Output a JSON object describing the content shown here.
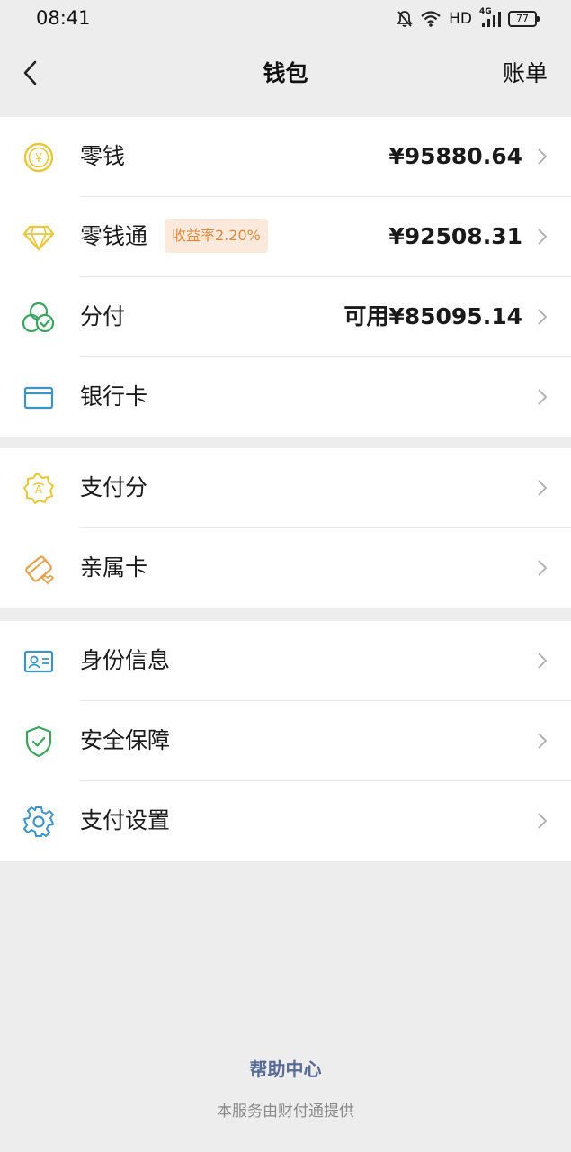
{
  "status_bar": {
    "time": "08:41",
    "network_label": "HD",
    "signal_label": "4G",
    "battery": "77"
  },
  "nav": {
    "title": "钱包",
    "right_label": "账单"
  },
  "groups": [
    [
      {
        "label": "零钱",
        "value": "¥95880.64",
        "icon": "coin-icon"
      },
      {
        "label": "零钱通",
        "badge": "收益率2.20%",
        "value": "¥92508.31",
        "icon": "diamond-icon"
      },
      {
        "label": "分付",
        "value": "可用¥85095.14",
        "icon": "circles-check-icon"
      },
      {
        "label": "银行卡",
        "value": "",
        "icon": "bank-card-icon"
      }
    ],
    [
      {
        "label": "支付分",
        "value": "",
        "icon": "score-badge-icon"
      },
      {
        "label": "亲属卡",
        "value": "",
        "icon": "family-card-icon"
      }
    ],
    [
      {
        "label": "身份信息",
        "value": "",
        "icon": "id-card-icon"
      },
      {
        "label": "安全保障",
        "value": "",
        "icon": "shield-check-icon"
      },
      {
        "label": "支付设置",
        "value": "",
        "icon": "gear-icon"
      }
    ]
  ],
  "footer": {
    "help_label": "帮助中心",
    "provider_text": "本服务由财付通提供"
  },
  "colors": {
    "background": "#ededed",
    "badge_bg": "#fbe9dc",
    "badge_text": "#dd8a3f",
    "link": "#586b95",
    "coin": "#e8c63a",
    "green": "#3aa55d",
    "blue": "#3d94c8",
    "orange": "#e5a04e"
  }
}
